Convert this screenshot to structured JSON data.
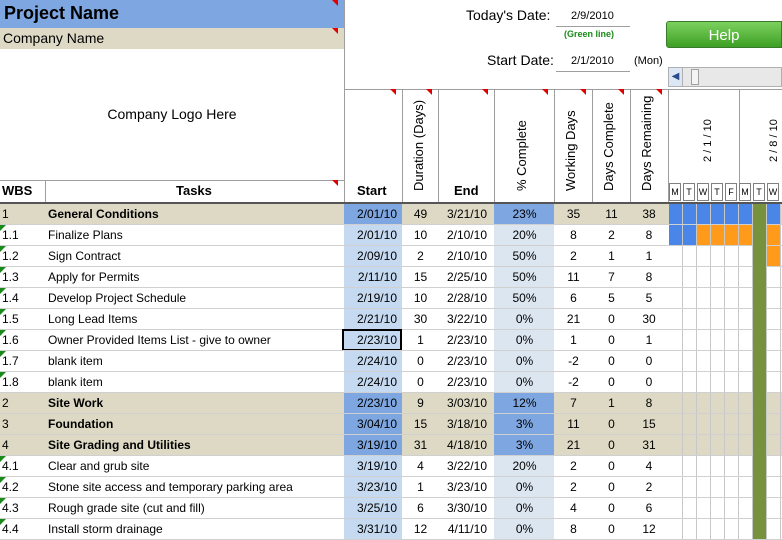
{
  "project": {
    "name": "Project Name",
    "company": "Company Name",
    "logo": "Company Logo Here"
  },
  "header": {
    "today_label": "Today's Date:",
    "today_value": "2/9/2010",
    "green_note": "(Green line)",
    "start_label": "Start Date:",
    "start_value": "2/1/2010",
    "start_day": "(Mon)",
    "help_label": "Help",
    "scroll_left_icon": "chevron-left-icon"
  },
  "columns": {
    "wbs": "WBS",
    "tasks": "Tasks",
    "start": "Start",
    "duration": "Duration (Days)",
    "end": "End",
    "pct": "% Complete",
    "working": "Working Days",
    "days_complete": "Days Complete",
    "days_remaining": "Days Remaining"
  },
  "gantt": {
    "weeks": [
      "2 / 1 / 10",
      "2 / 8 / 10"
    ],
    "days": [
      "M",
      "T",
      "W",
      "T",
      "F",
      "M",
      "T",
      "W"
    ]
  },
  "colors": {
    "accent_blue": "#7ea6e0",
    "summary_bg": "#ddd9c4",
    "blue_bar": "#4a86e8",
    "orange_bar": "#ff9a1a",
    "today_line": "#76923c",
    "start_col": "#c5d9f1",
    "pct_col": "#dce6f1"
  },
  "rows": [
    {
      "wbs": "1",
      "task": "General Conditions",
      "start": "2/01/10",
      "dur": "49",
      "end": "3/21/10",
      "pct": "23%",
      "work": "35",
      "done": "11",
      "rem": "38",
      "summary": true,
      "bar": "blue-full"
    },
    {
      "wbs": "1.1",
      "task": "Finalize Plans",
      "start": "2/01/10",
      "dur": "10",
      "end": "2/10/10",
      "pct": "20%",
      "work": "8",
      "done": "2",
      "rem": "8",
      "summary": false,
      "bar": "blue-orange"
    },
    {
      "wbs": "1.2",
      "task": "Sign Contract",
      "start": "2/09/10",
      "dur": "2",
      "end": "2/10/10",
      "pct": "50%",
      "work": "2",
      "done": "1",
      "rem": "1",
      "summary": false,
      "bar": "orange-late"
    },
    {
      "wbs": "1.3",
      "task": "Apply for Permits",
      "start": "2/11/10",
      "dur": "15",
      "end": "2/25/10",
      "pct": "50%",
      "work": "11",
      "done": "7",
      "rem": "8",
      "summary": false,
      "bar": "none"
    },
    {
      "wbs": "1.4",
      "task": "Develop Project Schedule",
      "start": "2/19/10",
      "dur": "10",
      "end": "2/28/10",
      "pct": "50%",
      "work": "6",
      "done": "5",
      "rem": "5",
      "summary": false,
      "bar": "none"
    },
    {
      "wbs": "1.5",
      "task": "Long Lead Items",
      "start": "2/21/10",
      "dur": "30",
      "end": "3/22/10",
      "pct": "0%",
      "work": "21",
      "done": "0",
      "rem": "30",
      "summary": false,
      "bar": "none"
    },
    {
      "wbs": "1.6",
      "task": "Owner Provided Items List - give to owner",
      "start": "2/23/10",
      "dur": "1",
      "end": "2/23/10",
      "pct": "0%",
      "work": "1",
      "done": "0",
      "rem": "1",
      "summary": false,
      "bar": "none",
      "selected": true
    },
    {
      "wbs": "1.7",
      "task": "blank item",
      "start": "2/24/10",
      "dur": "0",
      "end": "2/23/10",
      "pct": "0%",
      "work": "-2",
      "done": "0",
      "rem": "0",
      "summary": false,
      "bar": "none"
    },
    {
      "wbs": "1.8",
      "task": "blank item",
      "start": "2/24/10",
      "dur": "0",
      "end": "2/23/10",
      "pct": "0%",
      "work": "-2",
      "done": "0",
      "rem": "0",
      "summary": false,
      "bar": "none"
    },
    {
      "wbs": "2",
      "task": "Site Work",
      "start": "2/23/10",
      "dur": "9",
      "end": "3/03/10",
      "pct": "12%",
      "work": "7",
      "done": "1",
      "rem": "8",
      "summary": true,
      "bar": "none"
    },
    {
      "wbs": "3",
      "task": "Foundation",
      "start": "3/04/10",
      "dur": "15",
      "end": "3/18/10",
      "pct": "3%",
      "work": "11",
      "done": "0",
      "rem": "15",
      "summary": true,
      "bar": "none"
    },
    {
      "wbs": "4",
      "task": "Site Grading and Utilities",
      "start": "3/19/10",
      "dur": "31",
      "end": "4/18/10",
      "pct": "3%",
      "work": "21",
      "done": "0",
      "rem": "31",
      "summary": true,
      "bar": "none"
    },
    {
      "wbs": "4.1",
      "task": "Clear and grub site",
      "start": "3/19/10",
      "dur": "4",
      "end": "3/22/10",
      "pct": "20%",
      "work": "2",
      "done": "0",
      "rem": "4",
      "summary": false,
      "bar": "none"
    },
    {
      "wbs": "4.2",
      "task": "Stone site access and temporary parking area",
      "start": "3/23/10",
      "dur": "1",
      "end": "3/23/10",
      "pct": "0%",
      "work": "2",
      "done": "0",
      "rem": "2",
      "summary": false,
      "bar": "none"
    },
    {
      "wbs": "4.3",
      "task": "Rough grade site (cut and fill)",
      "start": "3/25/10",
      "dur": "6",
      "end": "3/30/10",
      "pct": "0%",
      "work": "4",
      "done": "0",
      "rem": "6",
      "summary": false,
      "bar": "none"
    },
    {
      "wbs": "4.4",
      "task": "Install storm drainage",
      "start": "3/31/10",
      "dur": "12",
      "end": "4/11/10",
      "pct": "0%",
      "work": "8",
      "done": "0",
      "rem": "12",
      "summary": false,
      "bar": "none"
    }
  ]
}
